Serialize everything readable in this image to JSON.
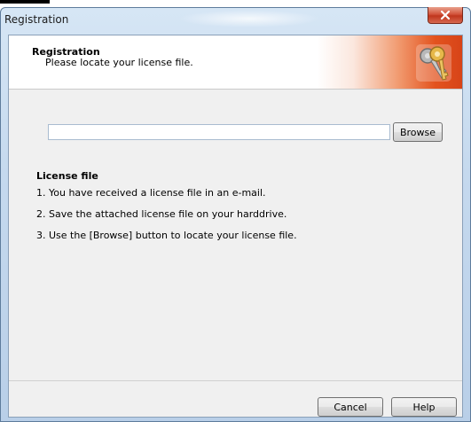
{
  "window": {
    "title": "Registration"
  },
  "header": {
    "title": "Registration",
    "subtitle": "Please locate your license file.",
    "icon": "keys-icon"
  },
  "file_input": {
    "value": "",
    "placeholder": ""
  },
  "buttons": {
    "browse": "Browse",
    "cancel": "Cancel",
    "help": "Help"
  },
  "license": {
    "title": "License file",
    "steps": [
      "1. You have received a license file in an e-mail.",
      "2. Save the attached license file on your harddrive.",
      "3. Use the [Browse] button to locate your license file."
    ]
  },
  "colors": {
    "header_accent": "#d74418",
    "window_frame": "#c5d9ee",
    "close_button": "#c0361d"
  }
}
